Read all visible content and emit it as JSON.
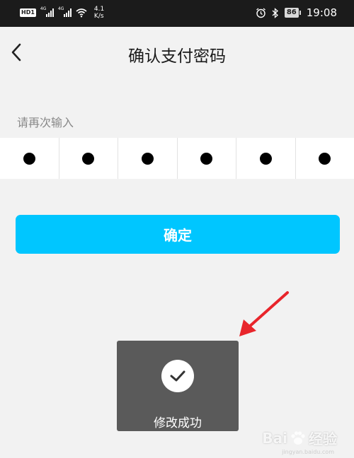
{
  "status_bar": {
    "hd": "HD",
    "sim1": "1",
    "signal_label": "4G",
    "speed_value": "4.1",
    "speed_unit": "K/s",
    "battery": "86",
    "time": "19:08"
  },
  "header": {
    "title": "确认支付密码"
  },
  "form": {
    "hint": "请再次输入",
    "pin_digits_filled": 6,
    "confirm_label": "确定"
  },
  "toast": {
    "message": "修改成功"
  },
  "watermark": {
    "text": "Bai",
    "text2": "经验",
    "sub": "jingyan.baidu.com"
  },
  "colors": {
    "accent": "#00c6ff",
    "toast_bg": "#5a5a5a",
    "annotation": "#e8252b"
  },
  "icons": {
    "back": "chevron-left-icon",
    "check": "check-icon",
    "alarm": "alarm-icon",
    "bluetooth": "bluetooth-icon",
    "wifi": "wifi-icon"
  }
}
